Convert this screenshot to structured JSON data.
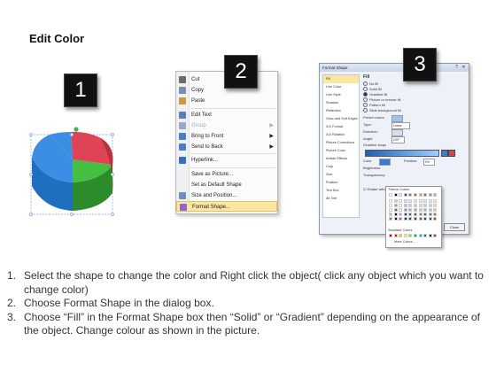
{
  "title": "Edit Color",
  "badges": [
    "1",
    "2",
    "3"
  ],
  "context_menu": {
    "items": [
      {
        "label": "Cut",
        "icon": "scissors-icon",
        "disabled": false,
        "submenu": false
      },
      {
        "label": "Copy",
        "icon": "copy-icon",
        "disabled": false,
        "submenu": false
      },
      {
        "label": "Paste",
        "icon": "paste-icon",
        "disabled": false,
        "submenu": false
      },
      {
        "label": "Edit Text",
        "icon": "edit-text-icon",
        "disabled": false,
        "submenu": false
      },
      {
        "label": "Group",
        "icon": "group-icon",
        "disabled": true,
        "submenu": true
      },
      {
        "label": "Bring to Front",
        "icon": "bring-front-icon",
        "disabled": false,
        "submenu": true
      },
      {
        "label": "Send to Back",
        "icon": "send-back-icon",
        "disabled": false,
        "submenu": true
      },
      {
        "label": "Hyperlink...",
        "icon": "hyperlink-icon",
        "disabled": false,
        "submenu": false
      },
      {
        "label": "Save as Picture...",
        "icon": "",
        "disabled": false,
        "submenu": false
      },
      {
        "label": "Set as Default Shape",
        "icon": "",
        "disabled": false,
        "submenu": false
      },
      {
        "label": "Size and Position...",
        "icon": "size-icon",
        "disabled": false,
        "submenu": false
      },
      {
        "label": "Format Shape...",
        "icon": "format-shape-icon",
        "disabled": false,
        "submenu": false,
        "highlighted": true
      }
    ]
  },
  "dialog": {
    "title": "Format Shape",
    "nav": [
      "Fill",
      "Line Color",
      "Line Style",
      "Shadow",
      "Reflection",
      "Glow and Soft Edges",
      "3-D Format",
      "3-D Rotation",
      "Picture Corrections",
      "Picture Color",
      "Artistic Effects",
      "Crop",
      "Size",
      "Position",
      "Text Box",
      "Alt Text"
    ],
    "section": "Fill",
    "options": [
      "No fill",
      "Solid fill",
      "Gradient fill",
      "Picture or texture fill",
      "Pattern fill",
      "Slide background fill"
    ],
    "selected_option": "Gradient fill",
    "labels": {
      "preset": "Preset colors:",
      "type": "Type:",
      "type_value": "Linear",
      "direction": "Direction:",
      "angle": "Angle:",
      "angle_value": "230°",
      "stops": "Gradient stops",
      "color": "Color",
      "position": "Position:",
      "position_value": "0%",
      "brightness": "Brightness:",
      "transparency": "Transparency:",
      "rotate": "Rotate with shape",
      "close": "Close"
    },
    "palette": {
      "theme_label": "Theme Colors",
      "standard_label": "Standard Colors",
      "more_label": "More Colors...",
      "theme_top": [
        "#ffffff",
        "#000000",
        "#eeece1",
        "#1f497d",
        "#4f81bd",
        "#c0504d",
        "#9bbb59",
        "#8064a2",
        "#4bacc6",
        "#f79646"
      ],
      "standard": [
        "#c00000",
        "#ff0000",
        "#ffc000",
        "#ffff00",
        "#92d050",
        "#00b050",
        "#00b0f0",
        "#0070c0",
        "#002060",
        "#7030a0"
      ]
    }
  },
  "instructions": [
    {
      "num": "1.",
      "text": "Select the shape to change the color and Right click the object( click any object which you want to change color)"
    },
    {
      "num": "2.",
      "text": "Choose Format Shape in the dialog box."
    },
    {
      "num": "3.",
      "text": "Choose “Fill” in the Format Shape box then “Solid” or “Gradient” depending on the appearance of the object. Change colour as shown in the picture."
    }
  ],
  "colors": {
    "pie_blue": "#2f7fd6",
    "pie_red": "#d23a4a",
    "pie_green": "#37a934",
    "highlight": "#fbe6a2"
  }
}
